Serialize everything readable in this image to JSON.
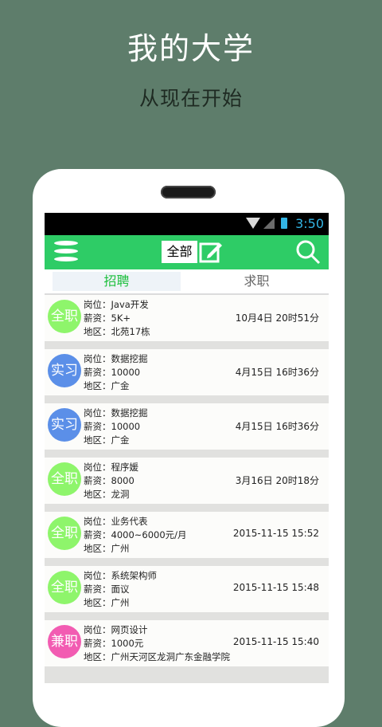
{
  "promo": {
    "title": "我的大学",
    "subtitle": "从现在开始"
  },
  "status_bar": {
    "time": "3:50",
    "icons": [
      "wifi-icon",
      "signal-icon",
      "battery-icon"
    ]
  },
  "toolbar": {
    "filter_label": "全部",
    "icons": [
      "menu-icon",
      "edit-icon",
      "search-icon"
    ]
  },
  "tabs": [
    {
      "label": "招聘",
      "active": true
    },
    {
      "label": "求职",
      "active": false
    }
  ],
  "colors": {
    "toolbar": "#2ecc66",
    "badge_fulltime": "#8ef56b",
    "badge_intern": "#5b8fe8",
    "badge_parttime": "#f25cb2"
  },
  "listings": [
    {
      "badge": "全职",
      "badge_color": "#8ef56b",
      "position": "岗位：Java开发",
      "salary": "薪资：5K+",
      "area": "地区：北苑17栋",
      "time": "10月4日  20时51分"
    },
    {
      "badge": "实习",
      "badge_color": "#5b8fe8",
      "position": "岗位：数据挖掘",
      "salary": "薪资：10000",
      "area": "地区：广金",
      "time": "4月15日  16时36分"
    },
    {
      "badge": "实习",
      "badge_color": "#5b8fe8",
      "position": "岗位：数据挖掘",
      "salary": "薪资：10000",
      "area": "地区：广金",
      "time": "4月15日  16时36分"
    },
    {
      "badge": "全职",
      "badge_color": "#8ef56b",
      "position": "岗位：程序媛",
      "salary": "薪资：8000",
      "area": "地区：龙洞",
      "time": "3月16日  20时18分"
    },
    {
      "badge": "全职",
      "badge_color": "#8ef56b",
      "position": "岗位：业务代表",
      "salary": "薪资：4000~6000元/月",
      "area": "地区：广州",
      "time": "2015-11-15 15:52"
    },
    {
      "badge": "全职",
      "badge_color": "#8ef56b",
      "position": "岗位：系统架构师",
      "salary": "薪资：面议",
      "area": "地区：广州",
      "time": "2015-11-15 15:48"
    },
    {
      "badge": "兼职",
      "badge_color": "#f25cb2",
      "position": "岗位：网页设计",
      "salary": "薪资：1000元",
      "area": "地区：广州天河区龙洞广东金融学院",
      "time": "2015-11-15 15:40"
    }
  ]
}
